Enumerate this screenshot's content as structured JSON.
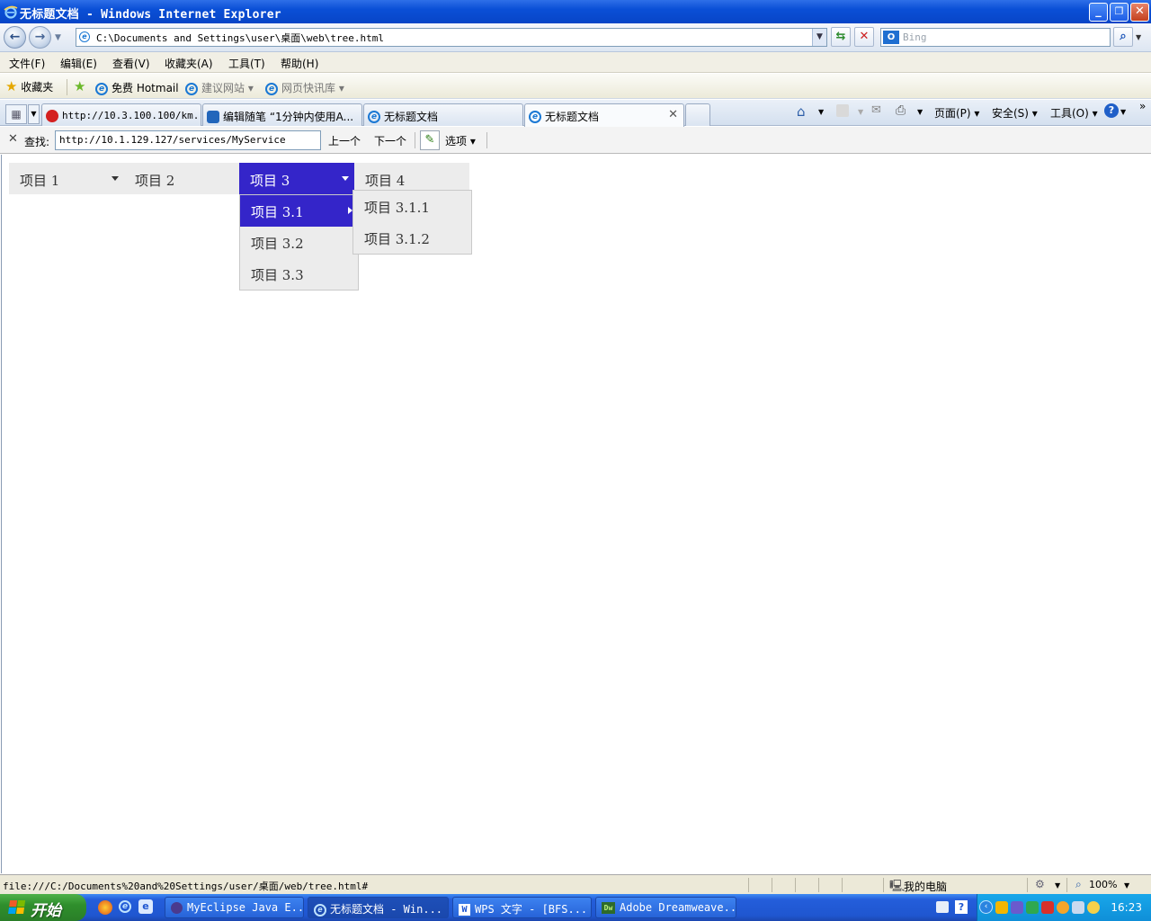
{
  "window": {
    "title": "无标题文档 - Windows Internet Explorer",
    "buttons": {
      "minimize": "_",
      "restore": "❐",
      "close": "✕"
    }
  },
  "address": {
    "url": "C:\\Documents and Settings\\user\\桌面\\web\\tree.html",
    "search_placeholder": "Bing"
  },
  "menubar": {
    "items": [
      "文件(F)",
      "编辑(E)",
      "查看(V)",
      "收藏夹(A)",
      "工具(T)",
      "帮助(H)"
    ]
  },
  "favorites": {
    "label": "收藏夹",
    "items": [
      "免费 Hotmail",
      "建议网站 ▾",
      "网页快讯库 ▾"
    ]
  },
  "tabs": [
    {
      "label": "http://10.3.100.100/km...",
      "active": false
    },
    {
      "label": "编辑随笔 “1分钟内使用A...",
      "active": false
    },
    {
      "label": "无标题文档",
      "active": false
    },
    {
      "label": "无标题文档",
      "active": true
    }
  ],
  "commandbar": {
    "page": "页面(P) ▾",
    "safety": "安全(S) ▾",
    "tools": "工具(O) ▾"
  },
  "findbar": {
    "label": "查找:",
    "value": "http://10.1.129.127/services/MyService",
    "prev": "上一个",
    "next": "下一个",
    "options": "选项 ▾"
  },
  "page_menu": {
    "top_items": [
      "项目 1",
      "项目 2",
      "项目 3",
      "项目 4"
    ],
    "active_top": "项目 3",
    "submenu": [
      "项目 3.1",
      "项目 3.2",
      "项目 3.3"
    ],
    "subsubmenu": [
      "项目 3.1.1",
      "项目 3.1.2"
    ],
    "highlight_color": "#3425c9",
    "background_color": "#ececec"
  },
  "statusbar": {
    "url": "file:///C:/Documents%20and%20Settings/user/桌面/web/tree.html#",
    "zone": "我的电脑",
    "zoom": "100%"
  },
  "taskbar": {
    "start": "开始",
    "tasks": [
      {
        "label": "MyEclipse Java E...",
        "active": false
      },
      {
        "label": "无标题文档 - Win...",
        "active": true
      },
      {
        "label": "WPS 文字 - [BFS...",
        "active": false
      },
      {
        "label": "Adobe Dreamweave...",
        "active": false
      }
    ],
    "clock": "16:23"
  }
}
